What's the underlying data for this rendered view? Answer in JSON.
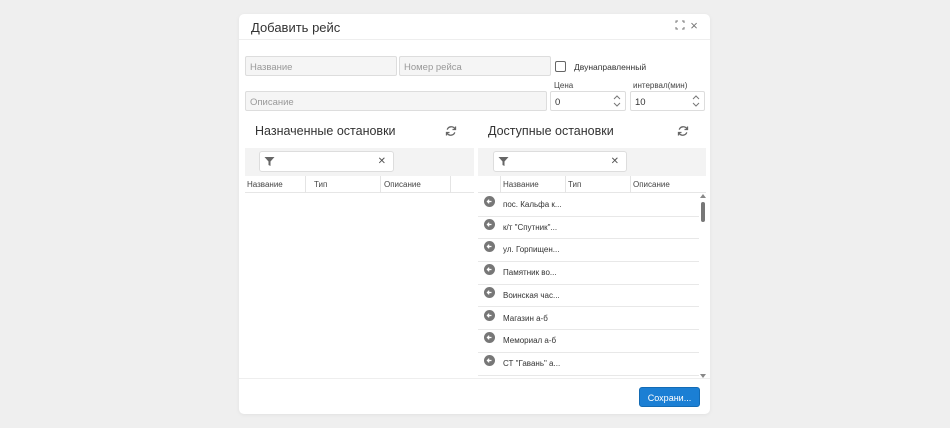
{
  "dialog": {
    "title": "Добавить рейс",
    "fields": {
      "name_placeholder": "Название",
      "number_placeholder": "Номер рейса",
      "description_placeholder": "Описание",
      "bidirectional_label": "Двунаправленный",
      "bidirectional_checked": false,
      "price_label": "Цена",
      "price_value": "0",
      "interval_label": "интервал(мин)",
      "interval_value": "10"
    },
    "assigned": {
      "title": "Назначенные остановки",
      "filter_value": "",
      "columns": [
        "Название",
        "Тип",
        "Описание"
      ],
      "rows": []
    },
    "available": {
      "title": "Доступные остановки",
      "filter_value": "",
      "columns": [
        "Название",
        "Тип",
        "Описание"
      ],
      "rows": [
        {
          "name": "пос. Кальфа к...",
          "type": "",
          "desc": ""
        },
        {
          "name": "к/т \"Спутник\"...",
          "type": "",
          "desc": ""
        },
        {
          "name": "ул. Горпищен...",
          "type": "",
          "desc": ""
        },
        {
          "name": "Памятник во...",
          "type": "",
          "desc": ""
        },
        {
          "name": "Воинская час...",
          "type": "",
          "desc": ""
        },
        {
          "name": "Магазин а-б",
          "type": "",
          "desc": ""
        },
        {
          "name": "Мемориал а-б",
          "type": "",
          "desc": ""
        },
        {
          "name": "СТ \"Гавань\" а...",
          "type": "",
          "desc": ""
        }
      ]
    },
    "save_label": "Сохрани...",
    "icons": {
      "maximize": "maximize-icon",
      "close": "close-icon",
      "refresh": "refresh-icon",
      "filter": "filter-icon",
      "clear": "clear-icon",
      "row_action": "arrow-left-circle-icon"
    },
    "colors": {
      "primary": "#1b7fd4",
      "background": "#efefef"
    }
  }
}
